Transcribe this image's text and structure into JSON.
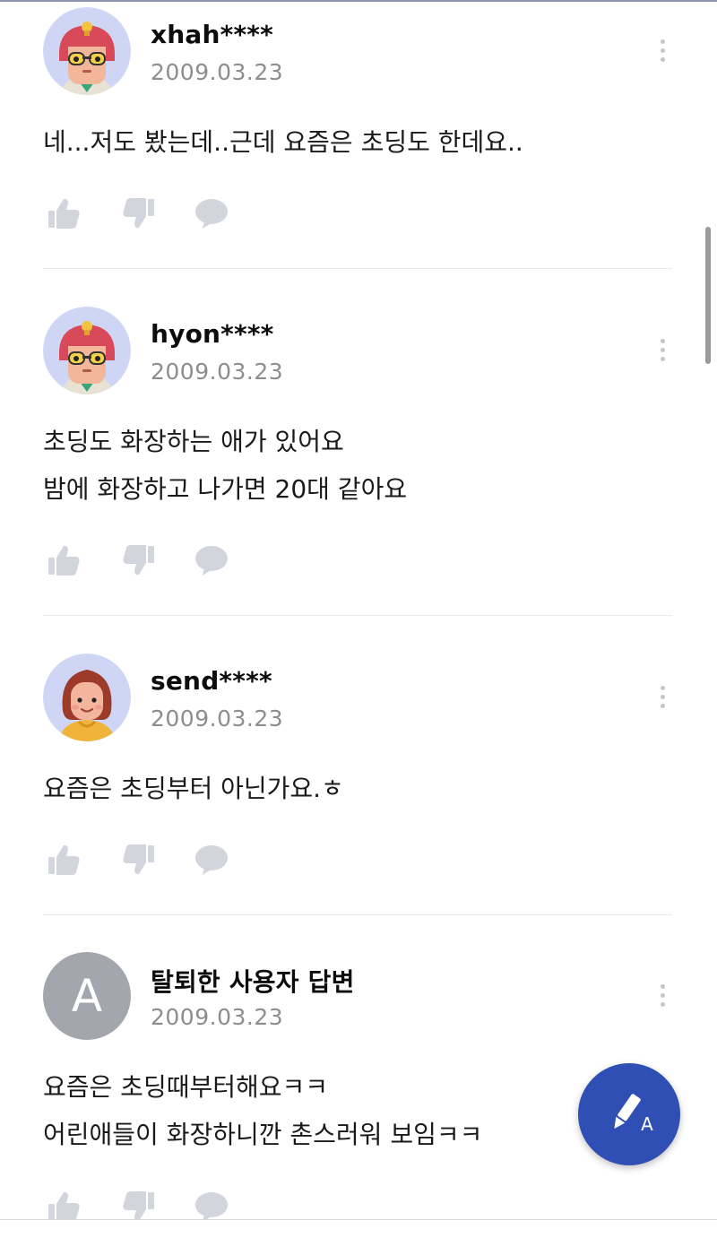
{
  "answers": [
    {
      "username": "xhah****",
      "date": "2009.03.23",
      "avatar": "character-avatar-red-helmet",
      "lines": [
        "네...저도 봤는데..근데 요즘은 초딩도 한데요.."
      ]
    },
    {
      "username": "hyon****",
      "date": "2009.03.23",
      "avatar": "character-avatar-red-helmet",
      "lines": [
        "초딩도 화장하는 애가 있어요",
        "밤에 화장하고 나가면 20대 같아요"
      ]
    },
    {
      "username": "send****",
      "date": "2009.03.23",
      "avatar": "character-avatar-brown-hair",
      "lines": [
        "요즘은 초딩부터 아닌가요.ㅎ"
      ]
    },
    {
      "username": "탈퇴한 사용자 답변",
      "date": "2009.03.23",
      "avatar": "letter-avatar",
      "avatar_letter": "A",
      "lines": [
        "요즘은 초딩때부터해요ㅋㅋ",
        "어린애들이 화장하니깐 촌스러워 보임ㅋㅋ"
      ]
    }
  ],
  "icons": {
    "like": "thumbs-up-icon",
    "dislike": "thumbs-down-icon",
    "comment": "speech-bubble-icon",
    "more": "more-vertical-icon",
    "fab": "write-answer-icon"
  },
  "fab": {
    "glyph": "A"
  },
  "colors": {
    "fab": "#2f4fb5",
    "icon": "#d3d5dc",
    "date": "#8d8d8d",
    "letter_avatar": "#a3a6ad"
  }
}
